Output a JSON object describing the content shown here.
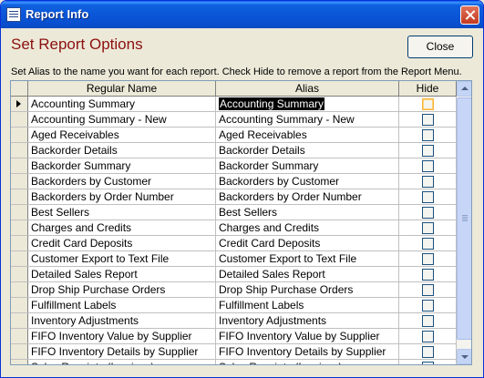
{
  "window": {
    "title": "Report Info"
  },
  "heading": "Set Report Options",
  "close_button_label": "Close",
  "instructions": "Set Alias to the name you want for each report. Check Hide to remove a report from the Report Menu.",
  "grid": {
    "columns": [
      "Regular Name",
      "Alias",
      "Hide"
    ],
    "rows": [
      {
        "name": "Accounting Summary",
        "alias": "Accounting Summary",
        "hide": false
      },
      {
        "name": "Accounting Summary - New",
        "alias": "Accounting Summary - New",
        "hide": false
      },
      {
        "name": "Aged Receivables",
        "alias": "Aged Receivables",
        "hide": false
      },
      {
        "name": "Backorder Details",
        "alias": "Backorder Details",
        "hide": false
      },
      {
        "name": "Backorder Summary",
        "alias": "Backorder Summary",
        "hide": false
      },
      {
        "name": "Backorders by Customer",
        "alias": "Backorders by Customer",
        "hide": false
      },
      {
        "name": "Backorders by Order Number",
        "alias": "Backorders by Order Number",
        "hide": false
      },
      {
        "name": "Best Sellers",
        "alias": "Best Sellers",
        "hide": false
      },
      {
        "name": "Charges and Credits",
        "alias": "Charges and Credits",
        "hide": false
      },
      {
        "name": "Credit Card Deposits",
        "alias": "Credit Card Deposits",
        "hide": false
      },
      {
        "name": "Customer Export to Text File",
        "alias": "Customer Export to Text File",
        "hide": false
      },
      {
        "name": "Detailed Sales Report",
        "alias": "Detailed Sales Report",
        "hide": false
      },
      {
        "name": "Drop Ship Purchase Orders",
        "alias": "Drop Ship Purchase Orders",
        "hide": false
      },
      {
        "name": "Fulfillment Labels",
        "alias": "Fulfillment Labels",
        "hide": false
      },
      {
        "name": "Inventory Adjustments",
        "alias": "Inventory Adjustments",
        "hide": false
      },
      {
        "name": "FIFO Inventory Value by Supplier",
        "alias": "FIFO Inventory Value by Supplier",
        "hide": false
      },
      {
        "name": "FIFO Inventory Details by Supplier",
        "alias": "FIFO Inventory Details by Supplier",
        "hide": false
      },
      {
        "name": "Sales Receipts (Invoices)",
        "alias": "Sales Receipts (Invoices)",
        "hide": false
      }
    ]
  },
  "icons": {
    "title": "form-icon",
    "close": "close-icon",
    "record_selector": "record-pointer-icon"
  }
}
